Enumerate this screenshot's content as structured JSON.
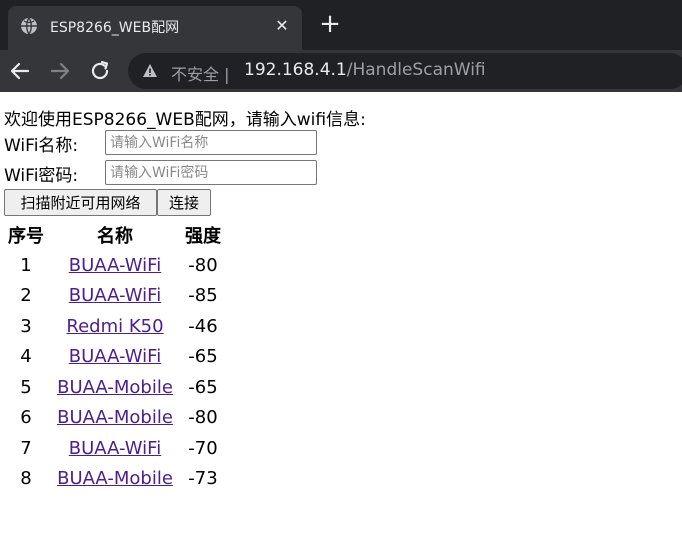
{
  "browser": {
    "tab_title": "ESP8266_WEB配网",
    "new_tab_label": "+",
    "close_label": "✕",
    "security_label": "不安全 |",
    "url_host": "192.168.4.1",
    "url_path": "/HandleScanWifi"
  },
  "page": {
    "greeting": "欢迎使用ESP8266_WEB配网，请输入wifi信息:",
    "ssid_label": "WiFi名称:",
    "ssid_placeholder": "请输入WiFi名称",
    "password_label": "WiFi密码:",
    "password_placeholder": "请输入WiFi密码",
    "scan_button": "扫描附近可用网络",
    "connect_button": "连接"
  },
  "table": {
    "headers": [
      "序号",
      "名称",
      "强度"
    ],
    "rows": [
      {
        "no": "1",
        "name": "BUAA-WiFi",
        "rssi": "-80"
      },
      {
        "no": "2",
        "name": "BUAA-WiFi",
        "rssi": "-85"
      },
      {
        "no": "3",
        "name": "Redmi K50",
        "rssi": "-46"
      },
      {
        "no": "4",
        "name": "BUAA-WiFi",
        "rssi": "-65"
      },
      {
        "no": "5",
        "name": "BUAA-Mobile",
        "rssi": "-65"
      },
      {
        "no": "6",
        "name": "BUAA-Mobile",
        "rssi": "-80"
      },
      {
        "no": "7",
        "name": "BUAA-WiFi",
        "rssi": "-70"
      },
      {
        "no": "8",
        "name": "BUAA-Mobile",
        "rssi": "-73"
      }
    ]
  },
  "icons": {
    "favicon": "globe-icon",
    "back": "back-arrow-icon",
    "forward": "forward-arrow-icon",
    "reload": "reload-icon",
    "security": "info-icon"
  },
  "colors": {
    "chrome_dark": "#202124",
    "chrome_toolbar": "#35363a",
    "link_visited": "#4b1e8c"
  }
}
